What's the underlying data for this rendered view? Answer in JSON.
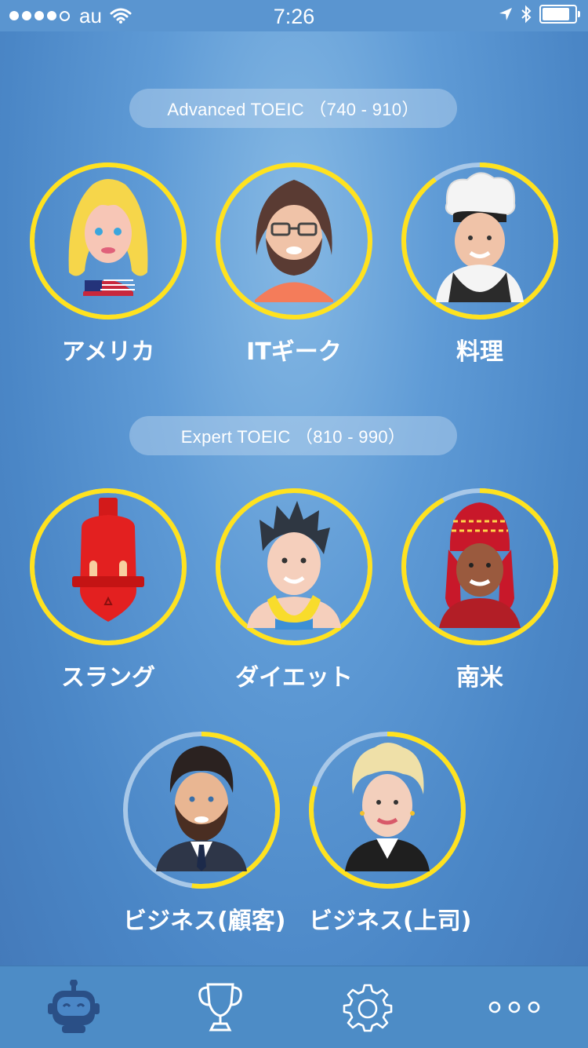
{
  "status_bar": {
    "carrier": "au",
    "time": "7:26"
  },
  "sections": [
    {
      "title": "Advanced TOEIC （740 - 910）"
    },
    {
      "title": "Expert TOEIC （810 - 990）"
    }
  ],
  "characters": [
    {
      "name": "アメリカ",
      "progress": 1.0,
      "avatar": "american-woman-avatar"
    },
    {
      "name": "ITギーク",
      "progress": 1.0,
      "avatar": "it-geek-avatar"
    },
    {
      "name": "料理",
      "progress": 0.9,
      "avatar": "chef-avatar"
    },
    {
      "name": "スラング",
      "progress": 1.0,
      "avatar": "robot-avatar"
    },
    {
      "name": "ダイエット",
      "progress": 1.0,
      "avatar": "fitness-man-avatar"
    },
    {
      "name": "南米",
      "progress": 0.92,
      "avatar": "south-american-avatar"
    },
    {
      "name": "ビジネス(顧客)",
      "progress": 0.52,
      "avatar": "business-customer-avatar"
    },
    {
      "name": "ビジネス(上司)",
      "progress": 0.8,
      "avatar": "business-boss-avatar"
    }
  ],
  "tabs": [
    {
      "name": "robot-tab-icon"
    },
    {
      "name": "trophy-tab-icon"
    },
    {
      "name": "settings-tab-icon"
    },
    {
      "name": "more-tab-icon"
    }
  ],
  "colors": {
    "ring_progress": "#ffe21f",
    "ring_track": "#a8c8e8",
    "tab_active": "#2a4f86",
    "tab_inactive": "#ffffff"
  }
}
